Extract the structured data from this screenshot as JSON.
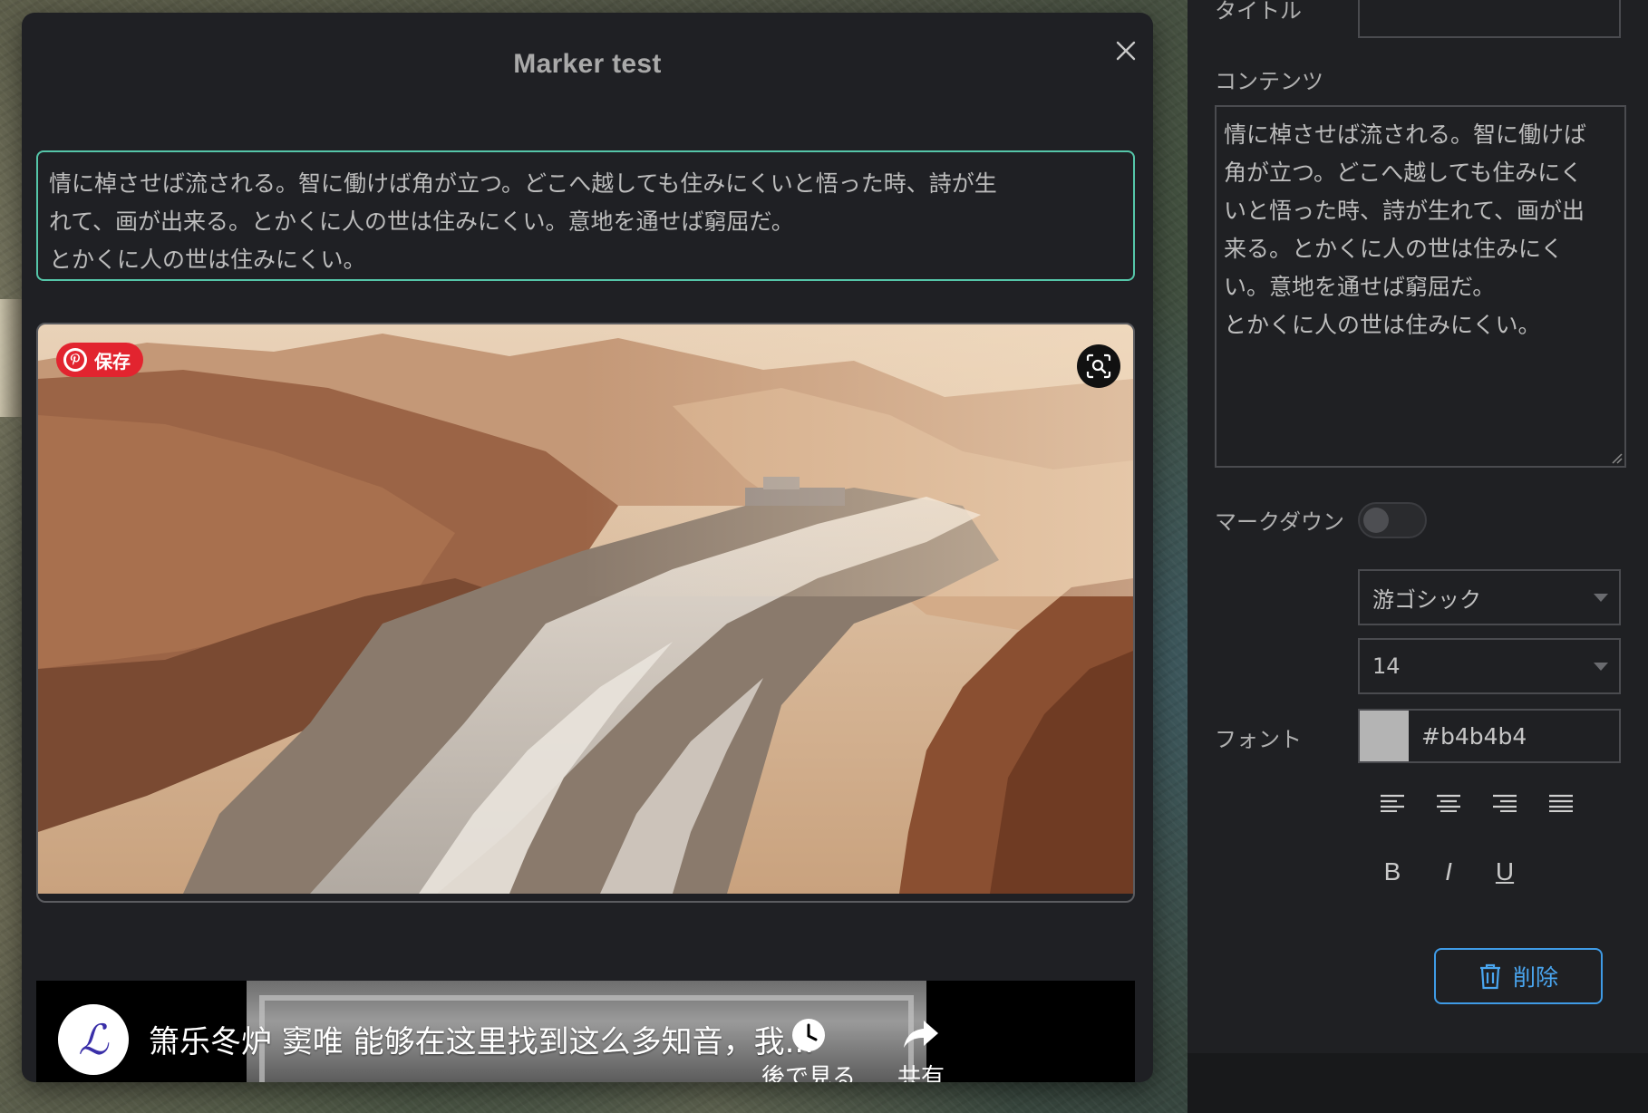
{
  "modal": {
    "title": "Marker test",
    "close_icon": "close-icon",
    "text_lines": [
      "情に棹させば流される。智に働けば角が立つ。どこへ越しても住みにくいと悟った時、詩が生",
      "れて、画が出来る。とかくに人の世は住みにくい。意地を通せば窮屈だ。",
      "とかくに人の世は住みにくい。"
    ],
    "image": {
      "pin_label": "保存",
      "pin_icon": "pinterest-icon",
      "lens_icon": "visual-search-icon"
    },
    "video": {
      "title": "箫乐冬炉 窦唯 能够在这里找到这么多知音，我...",
      "avatar_glyph": "ℒ",
      "watch_later_label": "後で見る",
      "share_label": "共有"
    }
  },
  "panel": {
    "title_label": "タイトル",
    "title_value": "",
    "content_label": "コンテンツ",
    "content_lines": [
      "情に棹させば流される。智に働けば",
      "角が立つ。どこへ越しても住みにく",
      "いと悟った時、詩が生れて、画が出",
      "来る。とかくに人の世は住みにく",
      "い。意地を通せば窮屈だ。",
      "とかくに人の世は住みにくい。"
    ],
    "markdown_label": "マークダウン",
    "markdown_enabled": false,
    "font_family_value": "游ゴシック",
    "font_size_value": "14",
    "font_label": "フォント",
    "font_color": "#b4b4b4",
    "bold_label": "B",
    "italic_label": "I",
    "underline_label": "U",
    "delete_label": "削除"
  },
  "colors": {
    "accent_green": "#55c6a9",
    "accent_blue": "#3f9be6",
    "pinterest_red": "#e2242f"
  }
}
